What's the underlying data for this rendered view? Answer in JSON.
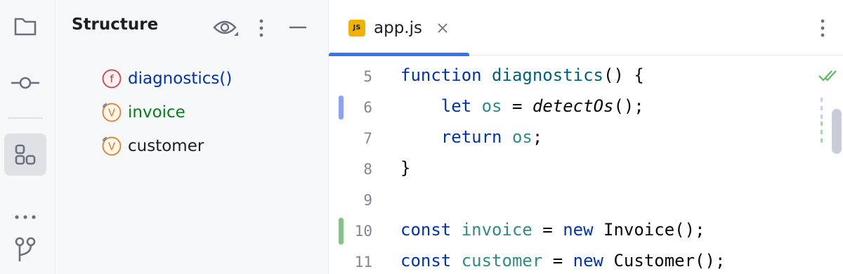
{
  "strip": {
    "items": [
      {
        "icon": "folder-icon",
        "name": "project"
      },
      {
        "icon": "commit-icon",
        "name": "commit"
      },
      {
        "icon": "structure-icon",
        "name": "structure",
        "active": true
      },
      {
        "icon": "more-icon",
        "name": "more"
      },
      {
        "icon": "git-branch-icon",
        "name": "git"
      }
    ]
  },
  "structure": {
    "title": "Structure",
    "items": [
      {
        "badge": "f",
        "label": "diagnostics()",
        "color": "#0033b3",
        "kind": "function"
      },
      {
        "badge": "V",
        "label": "invoice",
        "color": "#067d17",
        "kind": "variable"
      },
      {
        "badge": "V",
        "label": "customer",
        "color": "#1e1f22",
        "kind": "variable"
      }
    ]
  },
  "editor": {
    "tab": {
      "badge": "JS",
      "label": "app.js"
    },
    "line_numbers": [
      "5",
      "6",
      "7",
      "8",
      "9",
      "10",
      "11"
    ],
    "lines": [
      [
        {
          "t": "function",
          "c": "kw"
        },
        {
          "t": " "
        },
        {
          "t": "diagnostics",
          "c": "fn"
        },
        {
          "t": "() {"
        }
      ],
      [
        {
          "t": "    "
        },
        {
          "t": "let",
          "c": "kw"
        },
        {
          "t": " "
        },
        {
          "t": "os",
          "c": "vt"
        },
        {
          "t": " = "
        },
        {
          "t": "detectOs",
          "c": "it"
        },
        {
          "t": "();"
        }
      ],
      [
        {
          "t": "    "
        },
        {
          "t": "return",
          "c": "kw"
        },
        {
          "t": " "
        },
        {
          "t": "os",
          "c": "vt"
        },
        {
          "t": ";"
        }
      ],
      [
        {
          "t": "}"
        }
      ],
      [],
      [
        {
          "t": "const",
          "c": "kw"
        },
        {
          "t": " "
        },
        {
          "t": "invoice",
          "c": "vt"
        },
        {
          "t": " = "
        },
        {
          "t": "new",
          "c": "kw"
        },
        {
          "t": " Invoice();"
        }
      ],
      [
        {
          "t": "const",
          "c": "kw"
        },
        {
          "t": " "
        },
        {
          "t": "customer",
          "c": "vt"
        },
        {
          "t": " = "
        },
        {
          "t": "new",
          "c": "kw"
        },
        {
          "t": " Customer();"
        }
      ]
    ],
    "colors": {
      "modified": "#8da2f0",
      "added": "#88c08b",
      "keyword": "#0033b3",
      "function": "#00627a",
      "variable": "#2e8c85"
    }
  }
}
